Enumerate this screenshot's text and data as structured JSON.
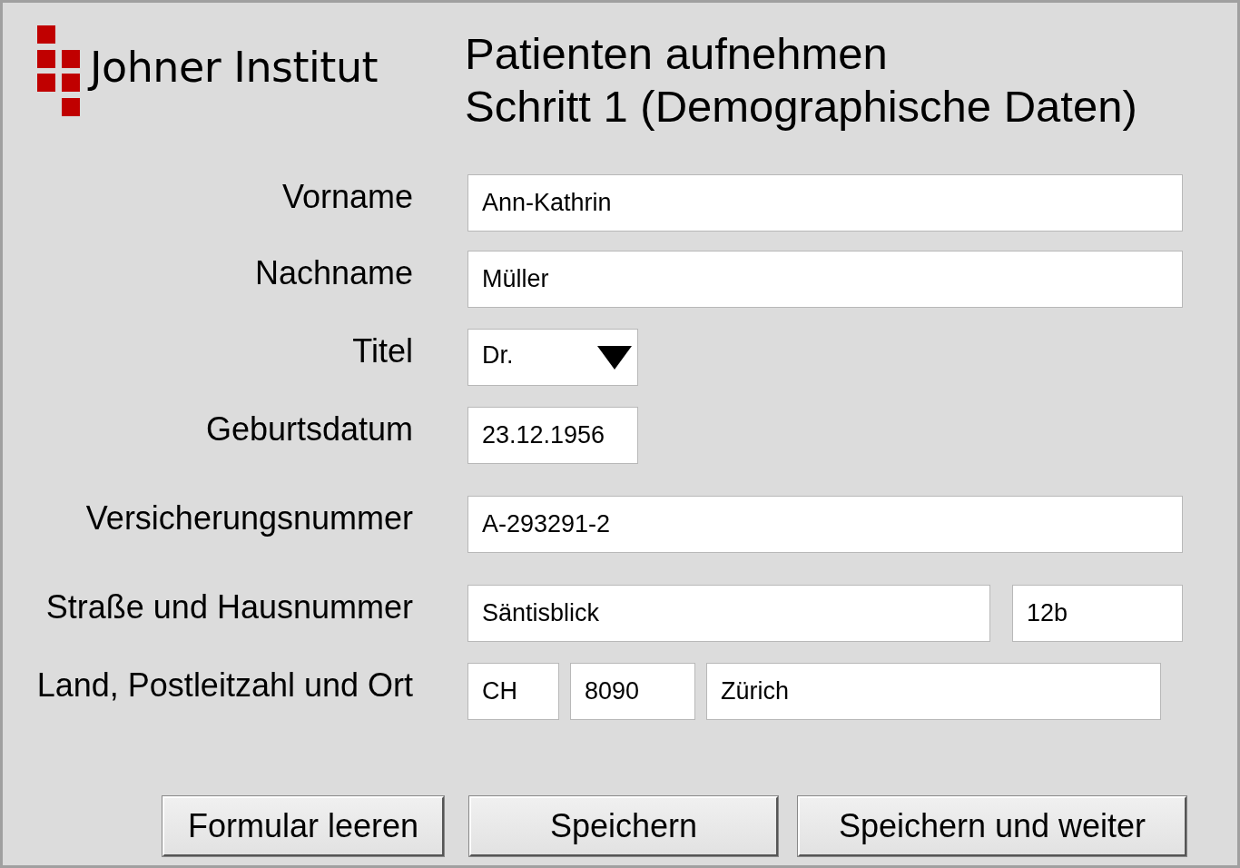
{
  "logo": {
    "text": "Johner Institut"
  },
  "heading": {
    "title": "Patienten aufnehmen",
    "subtitle": "Schritt 1 (Demographische Daten)"
  },
  "form_rows": [
    {
      "label": "Vorname",
      "fields": [
        {
          "kind": "text",
          "value": "Ann-Kathrin"
        }
      ]
    },
    {
      "label": "Nachname",
      "fields": [
        {
          "kind": "text",
          "value": "Müller"
        }
      ]
    },
    {
      "label": "Titel",
      "fields": [
        {
          "kind": "select",
          "value": "Dr."
        }
      ]
    },
    {
      "label": "Geburtsdatum",
      "fields": [
        {
          "kind": "text",
          "value": "23.12.1956"
        }
      ]
    },
    {
      "label": "Versicherungsnummer",
      "fields": [
        {
          "kind": "text",
          "value": "A-293291-2"
        }
      ]
    },
    {
      "label": "Straße und Hausnummer",
      "fields": [
        {
          "kind": "text",
          "value": "Säntisblick"
        },
        {
          "kind": "text",
          "value": "12b"
        }
      ]
    },
    {
      "label": "Land, Postleitzahl und Ort",
      "fields": [
        {
          "kind": "text",
          "value": "CH"
        },
        {
          "kind": "text",
          "value": "8090"
        },
        {
          "kind": "text",
          "value": "Zürich"
        }
      ]
    }
  ],
  "buttons": [
    "Formular leeren",
    "Speichern",
    "Speichern und weiter"
  ]
}
